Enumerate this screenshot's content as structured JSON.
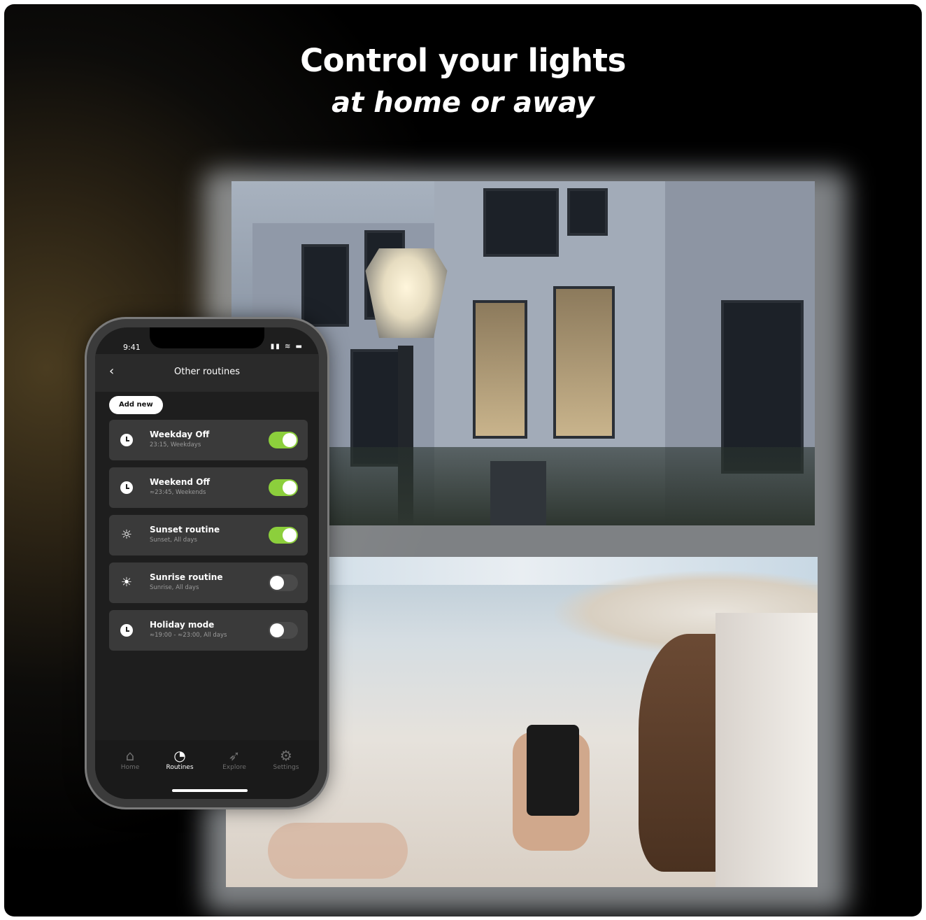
{
  "headline": {
    "title": "Control your lights",
    "subtitle": "at home or away"
  },
  "phone": {
    "status_time": "9:41",
    "screen_title": "Other routines",
    "add_button": "Add new",
    "routines": [
      {
        "name": "Weekday Off",
        "detail": "23:15, Weekdays",
        "icon": "clock-icon",
        "enabled": true
      },
      {
        "name": "Weekend Off",
        "detail": "≈23:45, Weekends",
        "icon": "clock-icon",
        "enabled": true
      },
      {
        "name": "Sunset routine",
        "detail": "Sunset, All days",
        "icon": "sunset-icon",
        "enabled": true
      },
      {
        "name": "Sunrise routine",
        "detail": "Sunrise, All days",
        "icon": "sunrise-icon",
        "enabled": false
      },
      {
        "name": "Holiday mode",
        "detail": "≈19:00 - ≈23:00, All days",
        "icon": "clock-icon",
        "enabled": false
      }
    ],
    "tabs": [
      {
        "label": "Home",
        "icon": "home-icon",
        "active": false
      },
      {
        "label": "Routines",
        "icon": "clock-icon",
        "active": true
      },
      {
        "label": "Explore",
        "icon": "rocket-icon",
        "active": false
      },
      {
        "label": "Settings",
        "icon": "gear-icon",
        "active": false
      }
    ],
    "accent_color": "#8ccf3c"
  }
}
